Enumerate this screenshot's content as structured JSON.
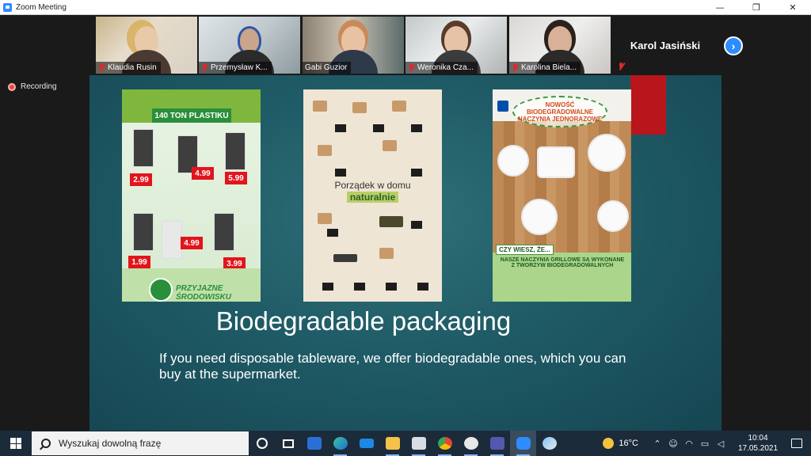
{
  "window": {
    "title": "Zoom Meeting",
    "minimize": "—",
    "maximize": "❐",
    "close": "✕"
  },
  "participants": [
    {
      "name": "Klaudia Rusin",
      "muted": true,
      "active": false
    },
    {
      "name": "Przemysław K...",
      "muted": true,
      "active": false
    },
    {
      "name": "Gabi Guzior",
      "muted": false,
      "active": true
    },
    {
      "name": "Weronika Cza...",
      "muted": true,
      "active": false
    },
    {
      "name": "Karolina Biela...",
      "muted": true,
      "active": false
    }
  ],
  "named_participant": {
    "name": "Karol Jasiński",
    "muted": true
  },
  "gallery_next": "›",
  "recording": {
    "label": "Recording"
  },
  "slide": {
    "title": "Biodegradable packaging",
    "body": "If you need disposable tableware, we offer biodegradable ones, which you can buy at the supermarket.",
    "leaflet1": {
      "big_text": "140 TON PLASTIKU",
      "prices": [
        "2.99",
        "4.99",
        "5.99",
        "4.99",
        "1.99",
        "3.99"
      ],
      "eco_text": "PRZYJAZNE ŚRODOWISKU"
    },
    "leaflet2": {
      "line1": "Porządek w domu",
      "line2": "naturalnie"
    },
    "leaflet3": {
      "badge": "NOWOŚĆ BIODEGRADOWALNE NACZYNIA JEDNORAZOWE",
      "czy": "CZY WIESZ, ŻE...",
      "info": "NASZE NACZYNIA GRILLOWE SĄ WYKONANE Z TWORZYW BIODEGRADOWALNYCH"
    }
  },
  "taskbar": {
    "search_placeholder": "Wyszukaj dowolną frazę",
    "temperature": "16°C",
    "time": "10:04",
    "date": "17.05.2021"
  },
  "colors": {
    "zoom_blue": "#2d8cff",
    "mute_red": "#e02828",
    "active_speaker": "#f5e04a",
    "slide_teal": "#1f5b66"
  }
}
